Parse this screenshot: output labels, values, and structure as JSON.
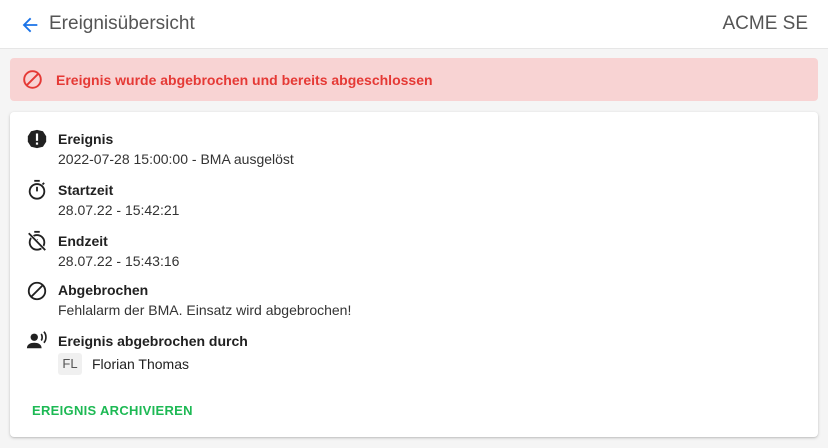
{
  "appbar": {
    "back_icon": "arrow-left-icon",
    "title": "Ereignisübersicht",
    "organization": "ACME SE"
  },
  "alert": {
    "icon": "block-icon",
    "text": "Ereignis wurde abgebrochen und bereits abgeschlossen",
    "color": "#e53935",
    "background": "#f8d3d3"
  },
  "details": {
    "event": {
      "icon": "alert-circle-icon",
      "label": "Ereignis",
      "value": "2022-07-28 15:00:00 - BMA ausgelöst"
    },
    "start": {
      "icon": "stopwatch-icon",
      "label": "Startzeit",
      "value": "28.07.22 - 15:42:21"
    },
    "end": {
      "icon": "timer-off-icon",
      "label": "Endzeit",
      "value": "28.07.22 - 15:43:16"
    },
    "aborted": {
      "icon": "block-icon",
      "label": "Abgebrochen",
      "value": "Fehlalarm der BMA. Einsatz wird abgebrochen!"
    },
    "aborted_by": {
      "icon": "person-speaking-icon",
      "label": "Ereignis abgebrochen durch",
      "person_initials": "FL",
      "person_name": "Florian Thomas"
    }
  },
  "actions": {
    "archive_label": "EREIGNIS ARCHIVIEREN",
    "archive_color": "#1db954"
  }
}
